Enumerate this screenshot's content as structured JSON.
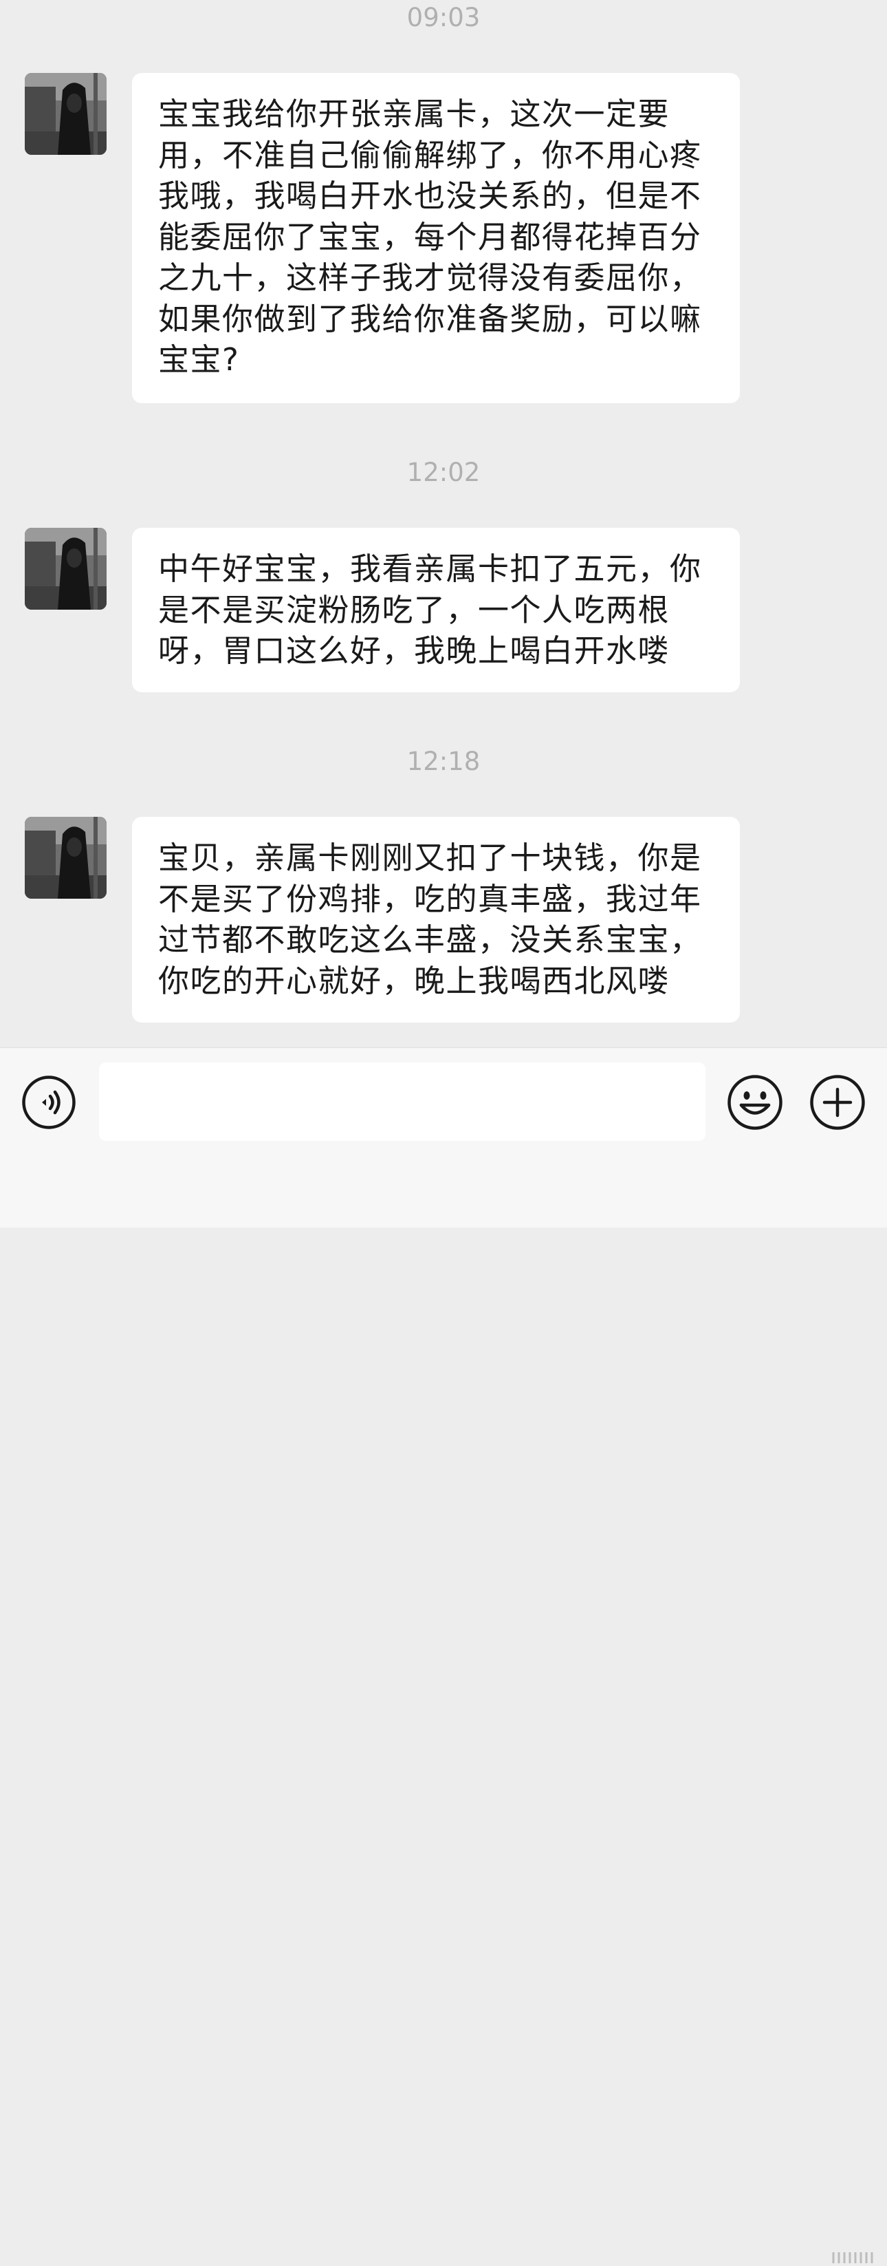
{
  "messages": [
    {
      "timestamp": "09:03",
      "text": "宝宝我给你开张亲属卡，这次一定要用，不准自己偷偷解绑了，你不用心疼我哦，我喝白开水也没关系的，但是不能委屈你了宝宝，每个月都得花掉百分之九十，这样子我才觉得没有委屈你，如果你做到了我给你准备奖励，可以嘛宝宝?"
    },
    {
      "timestamp": "12:02",
      "text": "中午好宝宝，我看亲属卡扣了五元，你是不是买淀粉肠吃了，一个人吃两根呀，胃口这么好，我晚上喝白开水喽"
    },
    {
      "timestamp": "12:18",
      "text": "宝贝，亲属卡刚刚又扣了十块钱，你是不是买了份鸡排，吃的真丰盛，我过年过节都不敢吃这么丰盛，没关系宝宝，你吃的开心就好，晚上我喝西北风喽"
    }
  ],
  "input_bar": {
    "input_value": "",
    "voice_icon": "voice-icon",
    "emoji_icon": "emoji-icon",
    "add_icon": "add-icon"
  },
  "colors": {
    "background": "#ededed",
    "bubble": "#ffffff",
    "timestamp": "#b0b0b0",
    "text": "#1a1a1a",
    "input_bar": "#f7f7f7"
  }
}
